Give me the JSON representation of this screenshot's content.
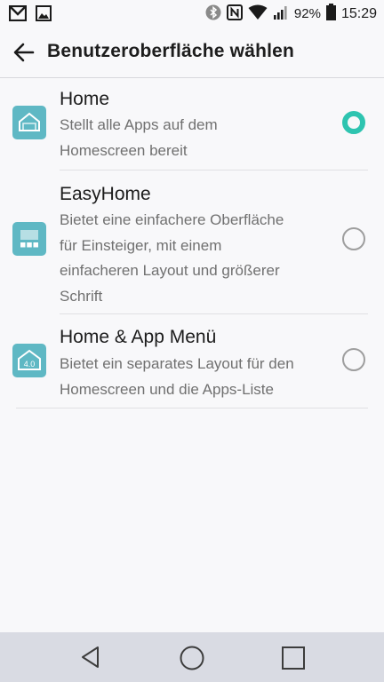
{
  "status_bar": {
    "left_icons": [
      "gmail-icon",
      "gallery-icon"
    ],
    "right_icons": [
      "bluetooth-icon",
      "nfc-icon",
      "wifi-icon",
      "signal-icon",
      "battery-icon"
    ],
    "battery_percent": "92%",
    "time": "15:29"
  },
  "header": {
    "title": "Benutzeroberfläche wählen"
  },
  "options": [
    {
      "name": "Home",
      "desc": [
        "Stellt alle Apps auf dem",
        "Homescreen bereit"
      ],
      "selected": true,
      "icon": "home-launcher-icon"
    },
    {
      "name": "EasyHome",
      "desc": [
        "Bietet eine einfachere Oberfläche",
        "für Einsteiger, mit einem",
        "einfacheren Layout und größerer",
        "Schrift"
      ],
      "selected": false,
      "icon": "easyhome-launcher-icon"
    },
    {
      "name": "Home & App Menü",
      "desc": [
        "Bietet ein separates Layout für den",
        "Homescreen und die Apps-Liste"
      ],
      "selected": false,
      "icon": "home-app-menu-launcher-icon",
      "icon_text": "4.0"
    }
  ],
  "colors": {
    "accent": "#2ec4b0",
    "icon_bg": "#5fb8c4",
    "nav_bg": "#d9dbe3"
  }
}
